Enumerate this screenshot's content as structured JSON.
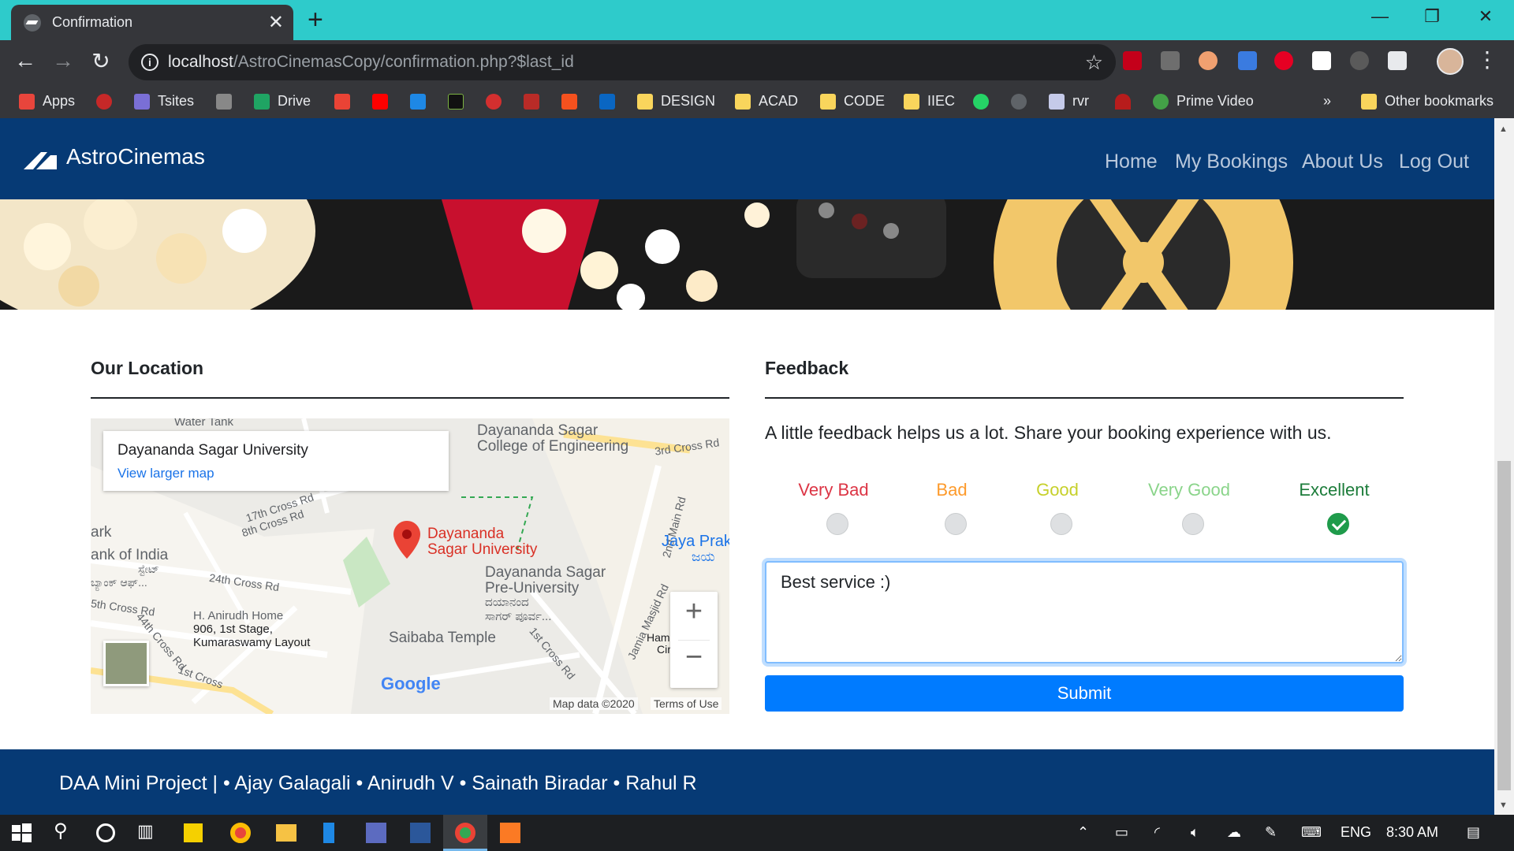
{
  "browser": {
    "tab_title": "Confirmation",
    "url_host": "localhost",
    "url_path": "/AstroCinemasCopy/confirmation.php?$last_id",
    "bookmarks": {
      "apps": "Apps",
      "tsites": "Tsites",
      "drive": "Drive",
      "design": "DESIGN",
      "acad": "ACAD",
      "code": "CODE",
      "iiec": "IIEC",
      "rvr": "rvr",
      "prime": "Prime Video",
      "more": "»",
      "other": "Other bookmarks"
    }
  },
  "site": {
    "brand": "AstroCinemas",
    "nav": {
      "home": "Home",
      "bookings": "My Bookings",
      "about": "About Us",
      "logout": "Log Out"
    }
  },
  "location": {
    "heading": "Our Location",
    "map": {
      "place": "Dayananda Sagar University",
      "larger_map": "View larger map",
      "pin_label_1": "Dayananda",
      "pin_label_2": "Sagar University",
      "college_1": "Dayananda Sagar",
      "college_2": "College of Engineering",
      "preu_1": "Dayananda Sagar",
      "preu_2": "Pre-University",
      "preu_3": "ದಯಾನಂದ",
      "preu_4": "ಸಾಗರ್ ಪೂರ್ವ...",
      "temple": "Saibaba Temple",
      "home_1": "H. Anirudh Home",
      "home_2": "906, 1st Stage,",
      "home_3": "Kumaraswamy Layout",
      "water": "Water Tank",
      "bank_1": "ark",
      "bank_2": "ank of India",
      "bank_3": "ಬ್ಯಾಂಕ್ ಆಫ್...",
      "bank_4": "ಸ್ಟೇಟ್",
      "rd_17": "17th Cross Rd",
      "rd_18": "8th Cross Rd",
      "rd_24": "24th Cross Rd",
      "rd_5": "5th Cross Rd",
      "rd_44": "44th Cross Rd",
      "rd_1": "1st Cross",
      "rd_3": "3rd Cross Rd",
      "rd_2main": "2nd Main Rd",
      "rd_jamia": "Jamia Masjid Rd",
      "rd_1st": "1st Cross Rd",
      "jaya_1": "Jaya Prak",
      "jaya_2": "ಜಯ",
      "ham_1": "Ham",
      "ham_2": "Cir",
      "google": "Google",
      "mapdata": "Map data ©2020",
      "terms": "Terms of Use"
    }
  },
  "feedback": {
    "heading": "Feedback",
    "prompt": "A little feedback helps us a lot. Share your booking experience with us.",
    "ratings": [
      {
        "label": "Very Bad",
        "color": "#dc3545"
      },
      {
        "label": "Bad",
        "color": "#fd9a2b"
      },
      {
        "label": "Good",
        "color": "#c6d02a"
      },
      {
        "label": "Very Good",
        "color": "#8ad48a"
      },
      {
        "label": "Excellent",
        "color": "#1c7c3a"
      }
    ],
    "selected": "Excellent",
    "comment": "Best service :)",
    "submit": "Submit"
  },
  "footer": {
    "text": "DAA Mini Project | • Ajay Galagali • Anirudh V • Sainath Biradar • Rahul R"
  },
  "taskbar": {
    "lang": "ENG",
    "time": "8:30 AM"
  },
  "colors": {
    "tabstrip": "#2ecbcb",
    "navbar": "#063a75",
    "primary": "#007bff"
  }
}
